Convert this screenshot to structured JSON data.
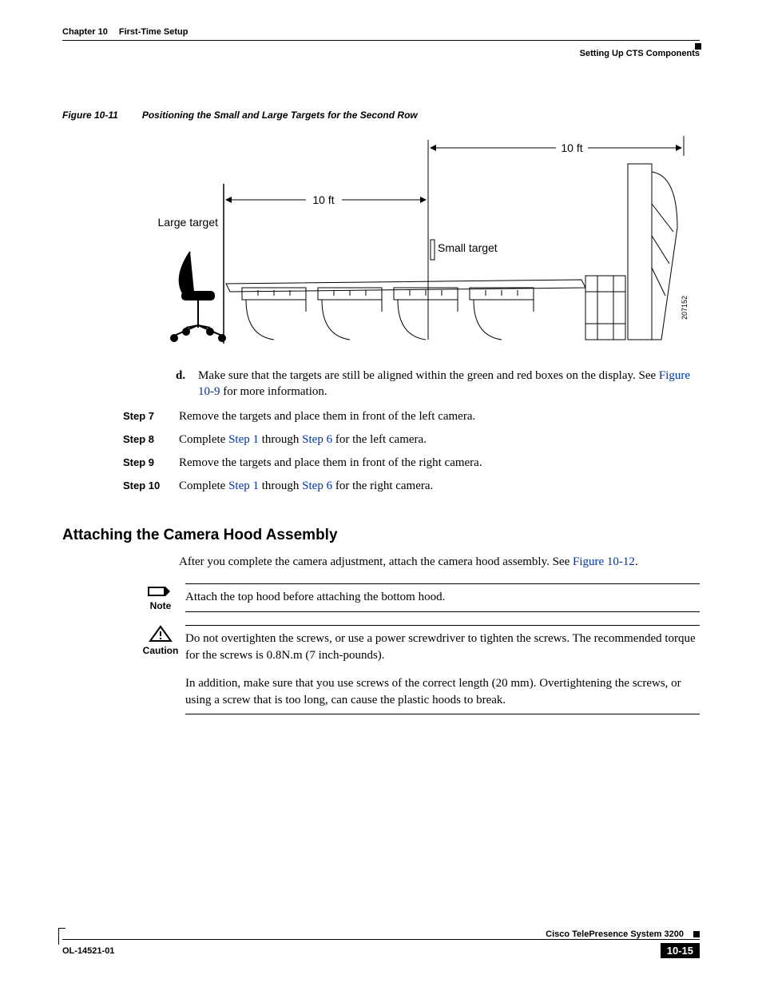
{
  "header": {
    "chapter": "Chapter 10",
    "chapter_title": "First-Time Setup",
    "section": "Setting Up CTS Components"
  },
  "figure11": {
    "label": "Figure 10-11",
    "title": "Positioning the Small and Large Targets for the Second Row",
    "dim_top": "10 ft",
    "dim_mid": "10 ft",
    "label_large": "Large target",
    "label_small": "Small target",
    "drawing_id": "207152"
  },
  "substep_d": {
    "marker": "d.",
    "text_pre": "Make sure that the targets are still be aligned within the green and red boxes on the display. See ",
    "link": "Figure 10-9",
    "text_post": " for more information."
  },
  "steps": {
    "s7": {
      "label": "Step 7",
      "body": "Remove the targets and place them in front of the left camera."
    },
    "s8": {
      "label": "Step 8",
      "pre": "Complete ",
      "l1": "Step 1",
      "mid": " through ",
      "l2": "Step 6",
      "post": " for the left camera."
    },
    "s9": {
      "label": "Step 9",
      "body": "Remove the targets and place them in front of the right camera."
    },
    "s10": {
      "label": "Step 10",
      "pre": "Complete ",
      "l1": "Step 1",
      "mid": " through ",
      "l2": "Step 6",
      "post": " for the right camera."
    }
  },
  "h2": "Attaching the Camera Hood Assembly",
  "intro": {
    "pre": "After you complete the camera adjustment, attach the camera hood assembly. See ",
    "link": "Figure 10-12",
    "post": "."
  },
  "note": {
    "label": "Note",
    "body": "Attach the top hood before attaching the bottom hood."
  },
  "caution": {
    "label": "Caution",
    "p1": "Do not overtighten the screws, or use a power screwdriver to tighten the screws. The recommended torque for the screws is 0.8N.m (7 inch-pounds).",
    "p2": "In addition, make sure that you use screws of the correct length (20 mm). Overtightening the screws, or using a screw that is too long, can cause the plastic hoods to break."
  },
  "footer": {
    "product": "Cisco TelePresence System 3200",
    "docnum": "OL-14521-01",
    "page": "10-15"
  }
}
